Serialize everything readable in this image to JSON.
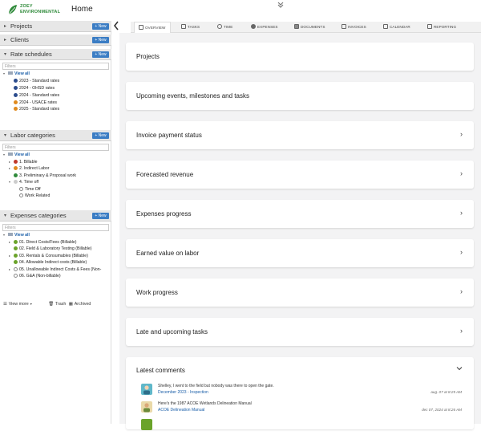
{
  "header": {
    "logo_line1": "ZOEY",
    "logo_line2": "ENVIRONMENTAL",
    "title": "Home",
    "collapse_icon": "double-chevron-down-icon"
  },
  "sidebar": {
    "new_label": "+ New",
    "filter_placeholder": "Filters",
    "sections": {
      "projects": {
        "label": "Projects"
      },
      "clients": {
        "label": "Clients"
      },
      "rate_schedules": {
        "label": "Rate schedules",
        "view_all": "View all",
        "items": [
          {
            "label": "2023 - Standard rates",
            "color": "#2b4c8c"
          },
          {
            "label": "2024 - OHSD rates",
            "color": "#2b4c8c"
          },
          {
            "label": "2024 - Standard rates",
            "color": "#2b4c8c"
          },
          {
            "label": "2024 - USACE rates",
            "color": "#e08a1e"
          },
          {
            "label": "2025 - Standard rates",
            "color": "#e08a1e"
          }
        ]
      },
      "labor_categories": {
        "label": "Labor categories",
        "view_all": "View all",
        "items": [
          {
            "label": "1. Billable",
            "color": "#c0392b"
          },
          {
            "label": "2. Indirect Labor",
            "color": "#e08a1e"
          },
          {
            "label": "3. Preliminary & Proposal work",
            "color": "#2f8a3a"
          },
          {
            "label": "4. Time off",
            "color": "#cccccc"
          },
          {
            "label": "Time Off",
            "color": "#ffffff"
          },
          {
            "label": "Work Related",
            "color": "#ffffff"
          }
        ]
      },
      "expenses_categories": {
        "label": "Expenses categories",
        "view_all": "View all",
        "items": [
          {
            "label": "01. Direct Costs/Fees (Billable)",
            "color": "#6aa32a"
          },
          {
            "label": "02. Field & Laboratory Testing (Billable)",
            "color": "#6aa32a"
          },
          {
            "label": "03. Rentals & Consumables (Billable)",
            "color": "#6aa32a"
          },
          {
            "label": "04. Allowable Indirect costs (Billable)",
            "color": "#6aa32a"
          },
          {
            "label": "05. Unallowable Indirect Costs & Fees (Non-",
            "color": "#ffffff"
          },
          {
            "label": "06. G&A (Non-billable)",
            "color": "#ffffff"
          }
        ]
      }
    },
    "footer": {
      "view_more": "View more",
      "trash": "Trash",
      "archived": "Archived"
    }
  },
  "tabs": [
    {
      "label": "OVERVIEW",
      "icon": "grid-icon",
      "active": true
    },
    {
      "label": "TASKS",
      "icon": "list-icon",
      "active": false
    },
    {
      "label": "TIME",
      "icon": "clock-icon",
      "active": false
    },
    {
      "label": "EXPENSES",
      "icon": "dollar-icon",
      "active": false
    },
    {
      "label": "DOCUMENTS",
      "icon": "folder-icon",
      "active": false
    },
    {
      "label": "INVOICES",
      "icon": "invoice-icon",
      "active": false
    },
    {
      "label": "CALENDAR",
      "icon": "calendar-icon",
      "active": false
    },
    {
      "label": "REPORTING",
      "icon": "chart-icon",
      "active": false
    }
  ],
  "cards": [
    {
      "title": "Projects",
      "chevron": false
    },
    {
      "title": "Upcoming events, milestones and tasks",
      "chevron": false
    },
    {
      "title": "Invoice payment status",
      "chevron": true
    },
    {
      "title": "Forecasted revenue",
      "chevron": true
    },
    {
      "title": "Expenses progress",
      "chevron": true
    },
    {
      "title": "Earned value on labor",
      "chevron": true
    },
    {
      "title": "Work progress",
      "chevron": true
    },
    {
      "title": "Late and upcoming tasks",
      "chevron": true
    }
  ],
  "latest_comments": {
    "title": "Latest comments",
    "items": [
      {
        "text": "Shelley, I went to the field but nobody was there to open the gate.",
        "link": "December 2023 - Inspection",
        "time": "aug. 07 at 8:25 AM"
      },
      {
        "text": "Here's the 1987 ACOE Wetlands Delineation Manual",
        "link": "ACOE Delineation Manual",
        "time": "dec 07, 2024 at 8:26 AM"
      }
    ]
  }
}
